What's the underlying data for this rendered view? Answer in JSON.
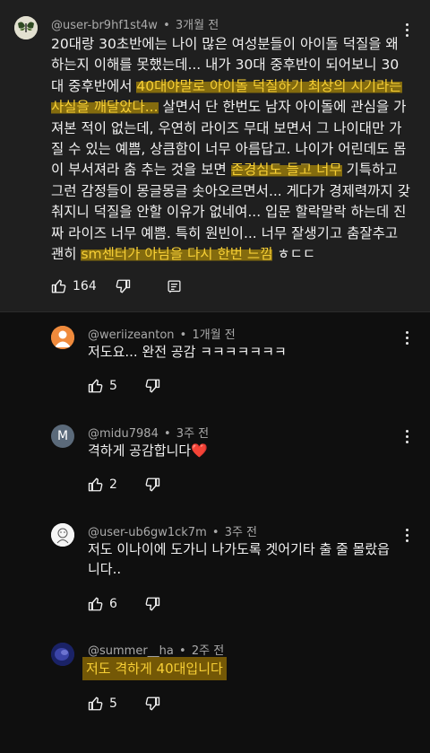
{
  "main_comment": {
    "author": "@user-br9hf1st4w",
    "time": "3개월 전",
    "lines": [
      [
        {
          "t": "20대랑 30초반에는 나이 많은 여성분들이 아이돌 덕질을 왜"
        }
      ],
      [
        {
          "t": "하는지 이해를 못했는데... 내가 30대 중후반이 되어보니 30"
        }
      ],
      [
        {
          "t": "대 중후반에서 "
        },
        {
          "t": "40대야말로 아이돌 덕질하기 최상의 시기라는",
          "hl": true
        }
      ],
      [
        {
          "t": "사실을 깨달았다...",
          "hl": true
        },
        {
          "t": " 살면서 단 한번도 남자 아이돌에 관심을 가"
        }
      ],
      [
        {
          "t": "져본 적이 없는데,  우연히 라이즈 무대 보면서 그 나이대만 가"
        }
      ],
      [
        {
          "t": "질 수 있는 예쁨, 상큼함이 너무 아름답고. 나이가 어린데도 몸"
        }
      ],
      [
        {
          "t": "이 부서져라 춤 추는 것을 보면 "
        },
        {
          "t": "존경심도 들고 너무",
          "hl": true
        },
        {
          "t": " 기특하고"
        }
      ],
      [
        {
          "t": "그런 감정들이 몽글몽글 솟아오르면서... 게다가 경제력까지 갖"
        }
      ],
      [
        {
          "t": "춰지니 덕질을 안할 이유가 없네여... 입문 할락말락 하는데 진"
        }
      ],
      [
        {
          "t": "짜 라이즈 너무 예쁨. 특히 원빈이... 너무 잘생기고 춤잘추고"
        }
      ],
      [
        {
          "t": "괜히 "
        },
        {
          "t": "sm센터가 아님을 다시 한번 느낌",
          "hl": true
        },
        {
          "t": " ㅎㄷㄷ"
        }
      ]
    ],
    "likes": "164"
  },
  "replies": [
    {
      "author": "@weriizeanton",
      "time": "1개월 전",
      "text_lines": [
        "저도요... 완전 공감 ㅋㅋㅋㅋㅋㅋㅋ"
      ],
      "likes": "5",
      "avatar": "person-orange"
    },
    {
      "author": "@midu7984",
      "time": "3주 전",
      "text_lines": [
        "격하게 공감합니다"
      ],
      "heart": "❤️",
      "likes": "2",
      "avatar_letter": "M"
    },
    {
      "author": "@user-ub6gw1ck7m",
      "time": "3주 전",
      "text_lines": [
        "저도 이나이에 도가니 나가도록 겟어기타 출 줄 몰랐읍",
        "니다.."
      ],
      "likes": "6",
      "avatar": "drawing"
    },
    {
      "author": "@summer__ha",
      "time": "2주 전",
      "highlight_text": "저도  격하게  40대입니다",
      "likes": "5",
      "avatar": "blue-blob"
    }
  ],
  "colors": {
    "background": "#0f0f0f",
    "main_bg": "#1f1f1f",
    "highlight": "#f7cf35",
    "heart": "#e8403b"
  },
  "icons": [
    "thumb-up-icon",
    "thumb-down-icon",
    "reply-icon",
    "more-vert-icon"
  ]
}
